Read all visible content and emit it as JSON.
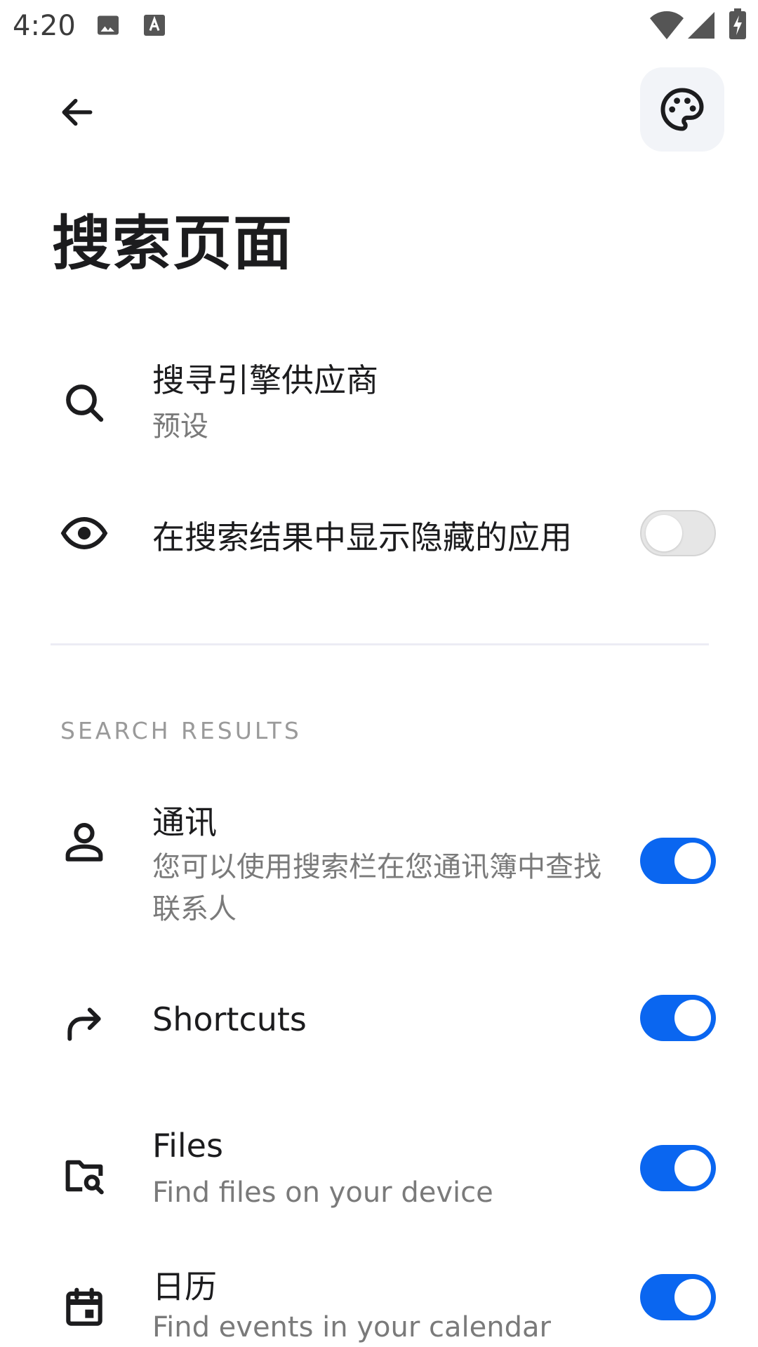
{
  "status_bar": {
    "time": "4:20",
    "icons": [
      "image-icon",
      "keyboard-icon",
      "wifi-icon",
      "signal-icon",
      "battery-charging-icon"
    ]
  },
  "top_bar": {
    "back_icon": "arrow-left-icon",
    "palette_icon": "palette-icon"
  },
  "page": {
    "title": "搜索页面"
  },
  "settings": {
    "search_provider": {
      "title": "搜寻引擎供应商",
      "subtitle": "预设",
      "icon": "search-icon"
    },
    "hidden_apps": {
      "title": "在搜索结果中显示隐藏的应用",
      "icon": "eye-icon",
      "enabled": false
    }
  },
  "search_results": {
    "header": "SEARCH RESULTS",
    "items": [
      {
        "title": "通讯",
        "subtitle": "您可以使用搜索栏在您通讯簿中查找联系人",
        "icon": "person-icon",
        "enabled": true
      },
      {
        "title": "Shortcuts",
        "subtitle": "",
        "icon": "shortcut-arrow-icon",
        "enabled": true
      },
      {
        "title": "Files",
        "subtitle": "Find files on your device",
        "icon": "folder-search-icon",
        "enabled": true
      },
      {
        "title": "日历",
        "subtitle": "Find events in your calendar",
        "icon": "calendar-icon",
        "enabled": true
      }
    ]
  },
  "colors": {
    "accent": "#0a66f0",
    "toggle_off": "#e6e6e6",
    "background": "#ffffff"
  }
}
